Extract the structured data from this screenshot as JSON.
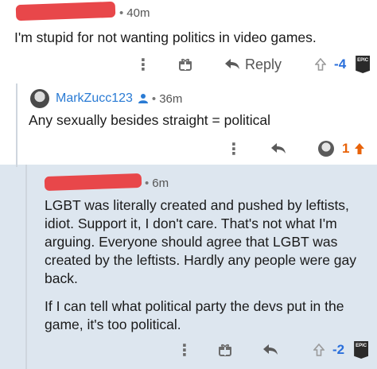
{
  "comment1": {
    "time": "40m",
    "text": "I'm stupid for not wanting politics in video games.",
    "reply_label": "Reply",
    "score": "-4",
    "score_color": "#2a6fdb"
  },
  "comment2": {
    "username": "MarkZucc123",
    "time": "36m",
    "text": "Any sexually besides straight = political",
    "score": "1",
    "score_color": "#e8630a"
  },
  "comment3": {
    "time": "6m",
    "paragraph1": "LGBT was literally created and pushed by leftists, idiot. Support it, I don't care. That's not what I'm arguing. Everyone should agree that LGBT was created by the leftists. Hardly any people were gay back.",
    "paragraph2": "If I can tell what political party the devs put in the game, it's too political.",
    "score": "-2",
    "score_color": "#2a6fdb"
  },
  "icons": {
    "kebab": "⋮",
    "epic_badge": "EPIC"
  }
}
